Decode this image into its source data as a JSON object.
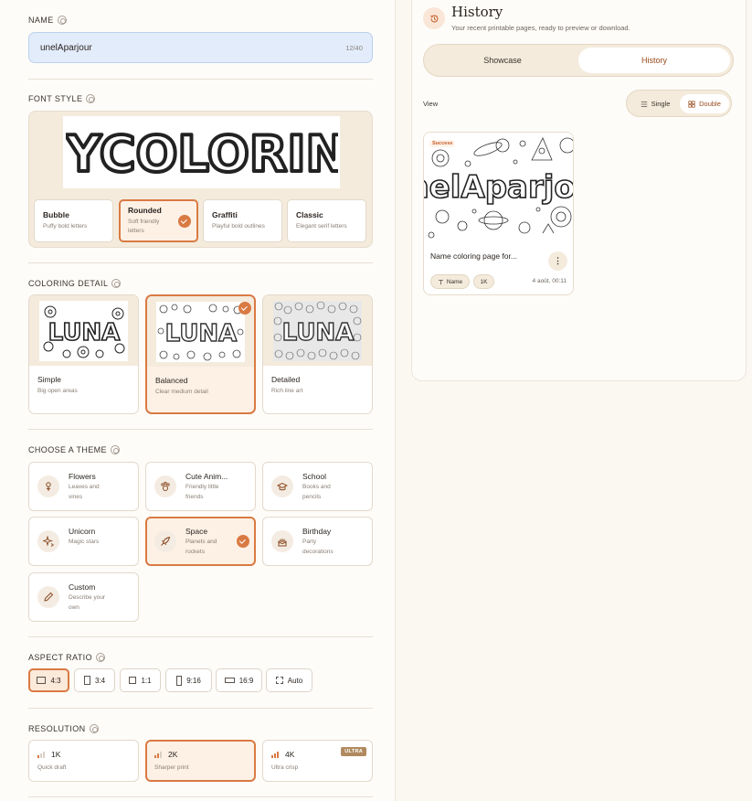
{
  "name": {
    "label": "NAME",
    "value": "unelAparjour",
    "count": "12/40"
  },
  "font_style": {
    "label": "FONT STYLE",
    "preview_text": "MYCOLORING",
    "options": [
      {
        "title": "Bubble",
        "sub": "Puffy bold letters"
      },
      {
        "title": "Rounded",
        "sub": "Soft friendly letters",
        "selected": true
      },
      {
        "title": "Graffiti",
        "sub": "Playful bold outlines"
      },
      {
        "title": "Classic",
        "sub": "Elegant serif letters"
      }
    ]
  },
  "coloring_detail": {
    "label": "COLORING DETAIL",
    "preview_word": "LUNA",
    "options": [
      {
        "title": "Simple",
        "sub": "Big open areas"
      },
      {
        "title": "Balanced",
        "sub": "Clear medium detail",
        "selected": true
      },
      {
        "title": "Detailed",
        "sub": "Rich line art"
      }
    ]
  },
  "theme": {
    "label": "CHOOSE A THEME",
    "options": [
      {
        "title": "Flowers",
        "sub": "Leaves and vines",
        "icon": "flower-icon"
      },
      {
        "title": "Cute Anim...",
        "sub": "Friendly little friends",
        "icon": "paw-icon"
      },
      {
        "title": "School",
        "sub": "Books and pencils",
        "icon": "graduation-cap-icon"
      },
      {
        "title": "Unicorn",
        "sub": "Magic stars",
        "icon": "sparkles-icon"
      },
      {
        "title": "Space",
        "sub": "Planets and rockets",
        "icon": "rocket-icon",
        "selected": true
      },
      {
        "title": "Birthday",
        "sub": "Party decorations",
        "icon": "cake-icon"
      },
      {
        "title": "Custom",
        "sub": "Describe your own",
        "icon": "pencil-icon"
      }
    ]
  },
  "aspect_ratio": {
    "label": "ASPECT RATIO",
    "options": [
      "4:3",
      "3:4",
      "1:1",
      "9:16",
      "16:9",
      "Auto"
    ],
    "selected": "4:3"
  },
  "resolution": {
    "label": "RESOLUTION",
    "options": [
      {
        "title": "1K",
        "sub": "Quick draft"
      },
      {
        "title": "2K",
        "sub": "Sharper print",
        "selected": true
      },
      {
        "title": "4K",
        "sub": "Ultra crisp",
        "badge": "ULTRA"
      }
    ]
  },
  "history": {
    "title": "History",
    "subtitle": "Your recent printable pages, ready to preview or download.",
    "tabs": [
      "Showcase",
      "History"
    ],
    "active_tab": "History",
    "view_label": "View",
    "view_options": [
      "Single",
      "Double"
    ],
    "active_view": "Double",
    "card": {
      "status": "Success",
      "image_text": "unelAparjour",
      "title": "Name coloring page for...",
      "chips": [
        "Name",
        "1K"
      ],
      "date": "4 août, 00:11"
    }
  },
  "colors": {
    "accent": "#d97a43",
    "panel": "#f4ebdc",
    "input": "#e3ecfa"
  }
}
